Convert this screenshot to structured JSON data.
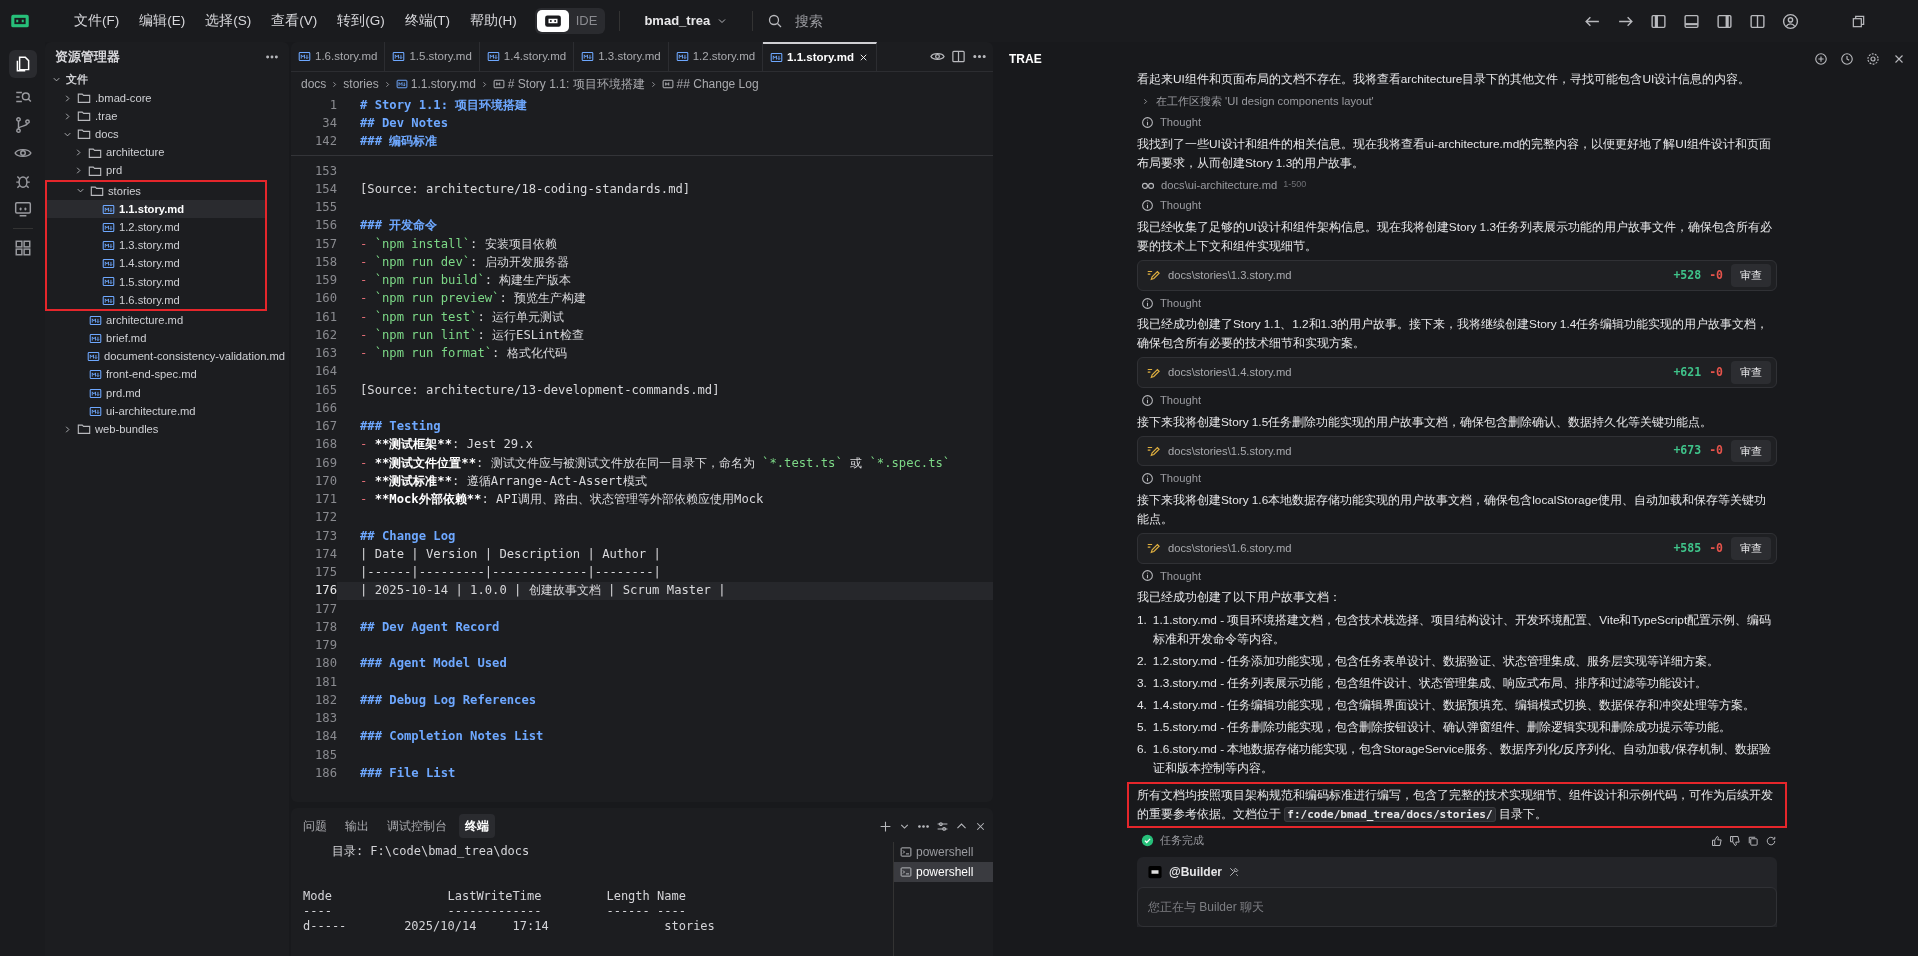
{
  "menu": [
    {
      "label": "文件(F)"
    },
    {
      "label": "编辑(E)"
    },
    {
      "label": "选择(S)"
    },
    {
      "label": "查看(V)"
    },
    {
      "label": "转到(G)"
    },
    {
      "label": "终端(T)"
    },
    {
      "label": "帮助(H)"
    }
  ],
  "mode_toggle": {
    "label": "IDE"
  },
  "project": {
    "name": "bmad_trea"
  },
  "search": {
    "placeholder": "搜索"
  },
  "explorer": {
    "title": "资源管理器",
    "tree": [
      {
        "label": "文件",
        "kind": "root",
        "expanded": true,
        "selected": false,
        "children": [
          {
            "label": ".bmad-core",
            "kind": "folder",
            "expanded": false,
            "selected": false
          },
          {
            "label": ".trae",
            "kind": "folder",
            "expanded": false,
            "selected": false
          },
          {
            "label": "docs",
            "kind": "folder",
            "expanded": true,
            "selected": false,
            "children": [
              {
                "label": "architecture",
                "kind": "folder",
                "expanded": false,
                "selected": false
              },
              {
                "label": "prd",
                "kind": "folder",
                "expanded": false,
                "selected": false
              },
              {
                "label": "stories",
                "kind": "folder",
                "expanded": true,
                "selected": false,
                "annotated": true,
                "children": [
                  {
                    "label": "1.1.story.md",
                    "kind": "file",
                    "selected": true
                  },
                  {
                    "label": "1.2.story.md",
                    "kind": "file",
                    "selected": false
                  },
                  {
                    "label": "1.3.story.md",
                    "kind": "file",
                    "selected": false
                  },
                  {
                    "label": "1.4.story.md",
                    "kind": "file",
                    "selected": false
                  },
                  {
                    "label": "1.5.story.md",
                    "kind": "file",
                    "selected": false
                  },
                  {
                    "label": "1.6.story.md",
                    "kind": "file",
                    "selected": false
                  }
                ]
              },
              {
                "label": "architecture.md",
                "kind": "file",
                "selected": false
              },
              {
                "label": "brief.md",
                "kind": "file",
                "selected": false
              },
              {
                "label": "document-consistency-validation.md",
                "kind": "file",
                "selected": false
              },
              {
                "label": "front-end-spec.md",
                "kind": "file",
                "selected": false
              },
              {
                "label": "prd.md",
                "kind": "file",
                "selected": false
              },
              {
                "label": "ui-architecture.md",
                "kind": "file",
                "selected": false
              }
            ]
          },
          {
            "label": "web-bundles",
            "kind": "folder",
            "expanded": false,
            "selected": false
          }
        ]
      }
    ]
  },
  "tabs": [
    {
      "label": "1.6.story.md",
      "selected": false
    },
    {
      "label": "1.5.story.md",
      "selected": false
    },
    {
      "label": "1.4.story.md",
      "selected": false
    },
    {
      "label": "1.3.story.md",
      "selected": false
    },
    {
      "label": "1.2.story.md",
      "selected": false
    },
    {
      "label": "1.1.story.md",
      "selected": true
    }
  ],
  "breadcrumb": [
    {
      "label": "docs",
      "kind": "folder"
    },
    {
      "label": "stories",
      "kind": "folder"
    },
    {
      "label": "1.1.story.md",
      "kind": "file"
    },
    {
      "label": "# Story 1.1: 项目环境搭建",
      "kind": "heading"
    },
    {
      "label": "## Change Log",
      "kind": "heading"
    }
  ],
  "sticky_lines": [
    {
      "num": "1",
      "segs": [
        {
          "heading": "# Story 1.1: 项目环境搭建"
        }
      ]
    },
    {
      "num": "34",
      "segs": [
        {
          "heading": "## Dev Notes"
        }
      ]
    },
    {
      "num": "142",
      "segs": [
        {
          "heading": "### 编码标准"
        }
      ]
    }
  ],
  "lines": [
    {
      "num": "153",
      "current": false
    },
    {
      "num": "154",
      "current": false,
      "segs": [
        {
          "text": "[Source: architecture/18-coding-standards.md]"
        }
      ]
    },
    {
      "num": "155",
      "current": false
    },
    {
      "num": "156",
      "current": false,
      "segs": [
        {
          "heading": "### 开发命令"
        }
      ]
    },
    {
      "num": "157",
      "current": false,
      "segs": [
        {
          "dash": "- "
        },
        {
          "code": "`npm install`"
        },
        {
          "text": ": 安装项目依赖"
        }
      ]
    },
    {
      "num": "158",
      "current": false,
      "segs": [
        {
          "dash": "- "
        },
        {
          "code": "`npm run dev`"
        },
        {
          "text": ": 启动开发服务器"
        }
      ]
    },
    {
      "num": "159",
      "current": false,
      "segs": [
        {
          "dash": "- "
        },
        {
          "code": "`npm run build`"
        },
        {
          "text": ": 构建生产版本"
        }
      ]
    },
    {
      "num": "160",
      "current": false,
      "segs": [
        {
          "dash": "- "
        },
        {
          "code": "`npm run preview`"
        },
        {
          "text": ": 预览生产构建"
        }
      ]
    },
    {
      "num": "161",
      "current": false,
      "segs": [
        {
          "dash": "- "
        },
        {
          "code": "`npm run test`"
        },
        {
          "text": ": 运行单元测试"
        }
      ]
    },
    {
      "num": "162",
      "current": false,
      "segs": [
        {
          "dash": "- "
        },
        {
          "code": "`npm run lint`"
        },
        {
          "text": ": 运行ESLint检查"
        }
      ]
    },
    {
      "num": "163",
      "current": false,
      "segs": [
        {
          "dash": "- "
        },
        {
          "code": "`npm run format`"
        },
        {
          "text": ": 格式化代码"
        }
      ]
    },
    {
      "num": "164",
      "current": false
    },
    {
      "num": "165",
      "current": false,
      "segs": [
        {
          "text": "[Source: architecture/13-development-commands.md]"
        }
      ]
    },
    {
      "num": "166",
      "current": false
    },
    {
      "num": "167",
      "current": false,
      "segs": [
        {
          "heading": "### Testing"
        }
      ]
    },
    {
      "num": "168",
      "current": false,
      "segs": [
        {
          "dash": "- "
        },
        {
          "bold": "**测试框架**"
        },
        {
          "text": ": Jest 29.x"
        }
      ]
    },
    {
      "num": "169",
      "current": false,
      "segs": [
        {
          "dash": "- "
        },
        {
          "bold": "**测试文件位置**"
        },
        {
          "text": ": 测试文件应与被测试文件放在同一目录下，命名为 "
        },
        {
          "code": "`*.test.ts`"
        },
        {
          "text": " 或 "
        },
        {
          "code": "`*.spec.ts`"
        }
      ]
    },
    {
      "num": "170",
      "current": false,
      "segs": [
        {
          "dash": "- "
        },
        {
          "bold": "**测试标准**"
        },
        {
          "text": ": 遵循Arrange-Act-Assert模式"
        }
      ]
    },
    {
      "num": "171",
      "current": false,
      "segs": [
        {
          "dash": "- "
        },
        {
          "bold": "**Mock外部依赖**"
        },
        {
          "text": ": API调用、路由、状态管理等外部依赖应使用Mock"
        }
      ]
    },
    {
      "num": "172",
      "current": false
    },
    {
      "num": "173",
      "current": false,
      "segs": [
        {
          "heading": "## Change Log"
        }
      ]
    },
    {
      "num": "174",
      "current": false,
      "segs": [
        {
          "text": "| Date | Version | Description | Author |"
        }
      ]
    },
    {
      "num": "175",
      "current": false,
      "segs": [
        {
          "text": "|------|---------|-------------|--------|"
        }
      ]
    },
    {
      "num": "176",
      "current": true,
      "segs": [
        {
          "text": "| 2025-10-14 | 1.0.0 | 创建故事文档 | Scrum Master |"
        }
      ]
    },
    {
      "num": "177",
      "current": false
    },
    {
      "num": "178",
      "current": false,
      "segs": [
        {
          "heading": "## Dev Agent Record"
        }
      ]
    },
    {
      "num": "179",
      "current": false
    },
    {
      "num": "180",
      "current": false,
      "segs": [
        {
          "heading": "### Agent Model Used"
        }
      ]
    },
    {
      "num": "181",
      "current": false
    },
    {
      "num": "182",
      "current": false,
      "segs": [
        {
          "heading": "### Debug Log References"
        }
      ]
    },
    {
      "num": "183",
      "current": false
    },
    {
      "num": "184",
      "current": false,
      "segs": [
        {
          "heading": "### Completion Notes List"
        }
      ]
    },
    {
      "num": "185",
      "current": false
    },
    {
      "num": "186",
      "current": false,
      "segs": [
        {
          "heading": "### File List"
        }
      ]
    }
  ],
  "panel": {
    "tabs": [
      {
        "label": "问题",
        "selected": false
      },
      {
        "label": "输出",
        "selected": false
      },
      {
        "label": "调试控制台",
        "selected": false
      },
      {
        "label": "终端",
        "selected": true
      }
    ],
    "terminal_lines": [
      "    目录: F:\\code\\bmad_trea\\docs",
      "Mode                LastWriteTime         Length Name",
      "----                -------------         ------ ----",
      "d-----        2025/10/14     17:14                stories"
    ],
    "sessions": [
      {
        "label": "powershell",
        "selected": false
      },
      {
        "label": "powershell",
        "selected": true
      }
    ]
  },
  "chat": {
    "title": "TRAE",
    "messages": [
      {
        "kind": "text",
        "text": "看起来UI组件和页面布局的文档不存在。我将查看architecture目录下的其他文件，寻找可能包含UI设计信息的内容。"
      },
      {
        "kind": "step",
        "text": "在工作区搜索 'UI design components layout'"
      },
      {
        "kind": "thought",
        "text": "Thought"
      },
      {
        "kind": "text",
        "text": "我找到了一些UI设计和组件的相关信息。现在我将查看ui-architecture.md的完整内容，以便更好地了解UI组件设计和页面布局要求，从而创建Story 1.3的用户故事。"
      },
      {
        "kind": "read",
        "path": "docs\\ui-architecture.md",
        "range": "1-500"
      },
      {
        "kind": "thought",
        "text": "Thought"
      },
      {
        "kind": "text",
        "text": "我已经收集了足够的UI设计和组件架构信息。现在我将创建Story 1.3任务列表展示功能的用户故事文件，确保包含所有必要的技术上下文和组件实现细节。"
      },
      {
        "kind": "edit",
        "path": "docs\\stories\\1.3.story.md",
        "added": "+528",
        "removed": "-0",
        "button": "审查"
      },
      {
        "kind": "thought",
        "text": "Thought"
      },
      {
        "kind": "text",
        "text": "我已经成功创建了Story 1.1、1.2和1.3的用户故事。接下来，我将继续创建Story 1.4任务编辑功能实现的用户故事文档，确保包含所有必要的技术细节和实现方案。"
      },
      {
        "kind": "edit",
        "path": "docs\\stories\\1.4.story.md",
        "added": "+621",
        "removed": "-0",
        "button": "审查"
      },
      {
        "kind": "thought",
        "text": "Thought"
      },
      {
        "kind": "text",
        "text": "接下来我将创建Story 1.5任务删除功能实现的用户故事文档，确保包含删除确认、数据持久化等关键功能点。"
      },
      {
        "kind": "edit",
        "path": "docs\\stories\\1.5.story.md",
        "added": "+673",
        "removed": "-0",
        "button": "审查"
      },
      {
        "kind": "thought",
        "text": "Thought"
      },
      {
        "kind": "text",
        "text": "接下来我将创建Story 1.6本地数据存储功能实现的用户故事文档，确保包含localStorage使用、自动加载和保存等关键功能点。"
      },
      {
        "kind": "edit",
        "path": "docs\\stories\\1.6.story.md",
        "added": "+585",
        "removed": "-0",
        "button": "审查"
      },
      {
        "kind": "thought",
        "text": "Thought"
      },
      {
        "kind": "text",
        "text": "我已经成功创建了以下用户故事文档："
      },
      {
        "kind": "list",
        "items": [
          {
            "num": "1.",
            "text": "1.1.story.md - 项目环境搭建文档，包含技术栈选择、项目结构设计、开发环境配置、Vite和TypeScript配置示例、编码标准和开发命令等内容。"
          },
          {
            "num": "2.",
            "text": "1.2.story.md - 任务添加功能实现，包含任务表单设计、数据验证、状态管理集成、服务层实现等详细方案。"
          },
          {
            "num": "3.",
            "text": "1.3.story.md - 任务列表展示功能，包含组件设计、状态管理集成、响应式布局、排序和过滤等功能设计。"
          },
          {
            "num": "4.",
            "text": "1.4.story.md - 任务编辑功能实现，包含编辑界面设计、数据预填充、编辑模式切换、数据保存和冲突处理等方案。"
          },
          {
            "num": "5.",
            "text": "1.5.story.md - 任务删除功能实现，包含删除按钮设计、确认弹窗组件、删除逻辑实现和删除成功提示等功能。"
          },
          {
            "num": "6.",
            "text": "1.6.story.md - 本地数据存储功能实现，包含StorageService服务、数据序列化/反序列化、自动加载/保存机制、数据验证和版本控制等内容。"
          }
        ]
      },
      {
        "kind": "rich",
        "annotated": true,
        "parts": [
          {
            "text": "所有文档均按照项目架构规范和编码标准进行编写，包含了完整的技术实现细节、组件设计和示例代码，可作为后续开发的重要参考依据。文档位于 "
          },
          {
            "code": "f:/code/bmad_trea/docs/stories/"
          },
          {
            "text": " 目录下。"
          }
        ]
      },
      {
        "kind": "status",
        "text": "任务完成"
      }
    ],
    "composer": {
      "agent": "@Builder",
      "placeholder": "您正在与 Builder 聊天"
    }
  }
}
